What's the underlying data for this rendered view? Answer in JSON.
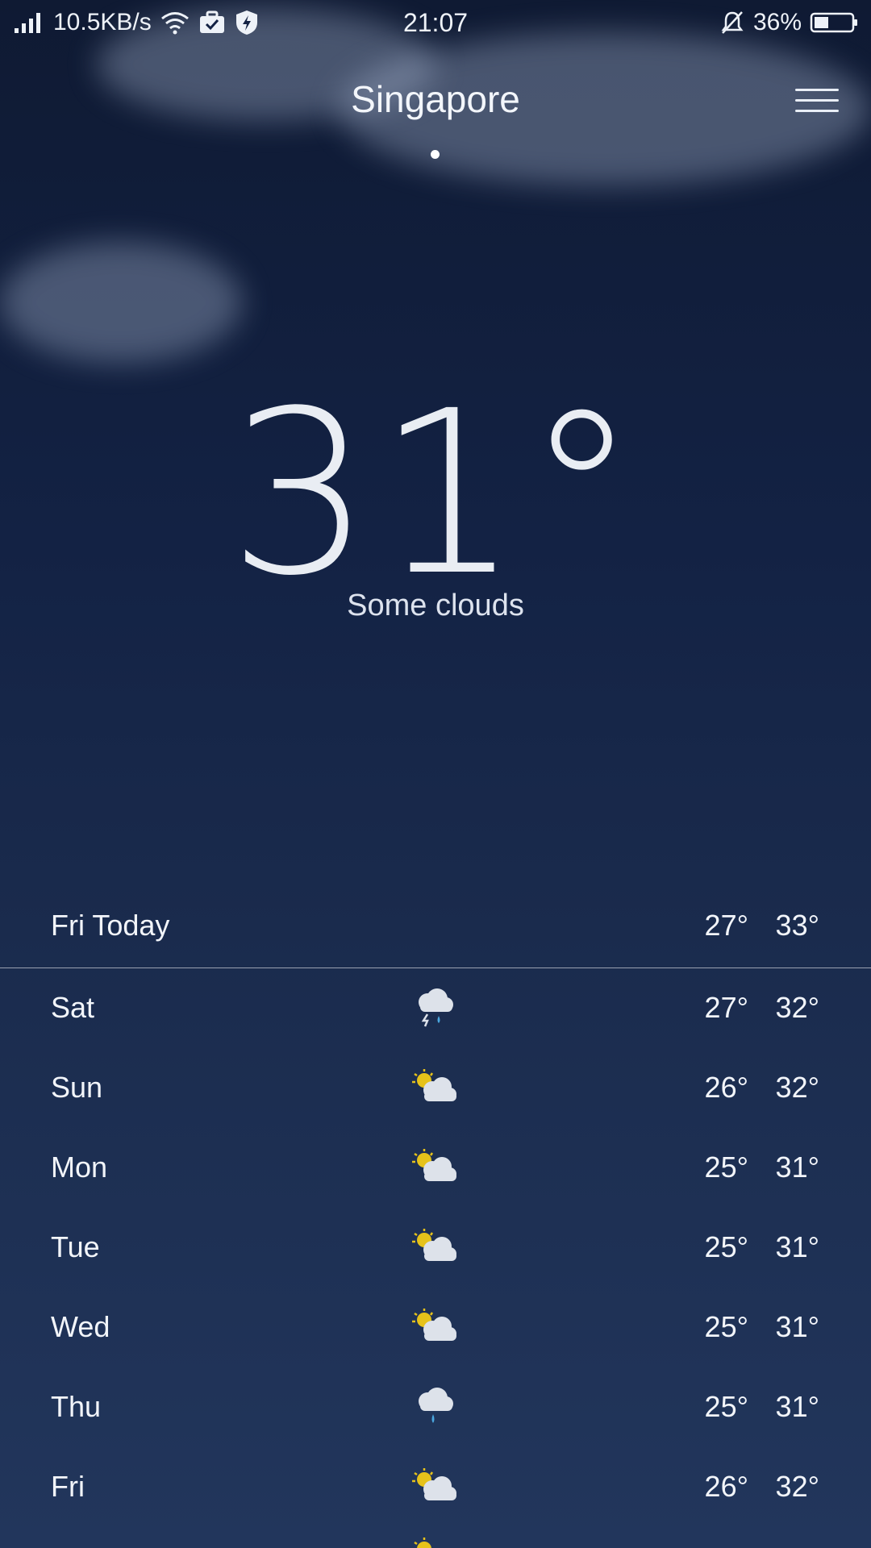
{
  "status_bar": {
    "network_speed": "10.5KB/s",
    "time": "21:07",
    "battery": "36%",
    "icons": [
      "signal-icon",
      "wifi-icon",
      "briefcase-check-icon",
      "shield-bolt-icon",
      "bell-off-icon",
      "battery-icon"
    ]
  },
  "header": {
    "city": "Singapore",
    "menu_icon": "hamburger-menu-icon"
  },
  "current": {
    "temperature": "31°",
    "condition": "Some clouds"
  },
  "forecast": [
    {
      "day": "Fri  Today",
      "icon": "",
      "low": "27°",
      "high": "33°"
    },
    {
      "day": "Sat",
      "icon": "thunder-rain-icon",
      "low": "27°",
      "high": "32°"
    },
    {
      "day": "Sun",
      "icon": "partly-cloudy-icon",
      "low": "26°",
      "high": "32°"
    },
    {
      "day": "Mon",
      "icon": "partly-cloudy-icon",
      "low": "25°",
      "high": "31°"
    },
    {
      "day": "Tue",
      "icon": "partly-cloudy-icon",
      "low": "25°",
      "high": "31°"
    },
    {
      "day": "Wed",
      "icon": "partly-cloudy-icon",
      "low": "25°",
      "high": "31°"
    },
    {
      "day": "Thu",
      "icon": "rain-icon",
      "low": "25°",
      "high": "31°"
    },
    {
      "day": "Fri",
      "icon": "partly-cloudy-icon",
      "low": "26°",
      "high": "32°"
    }
  ],
  "colors": {
    "background_top": "#0f1a33",
    "background_bottom": "#22365c",
    "sun": "#e6c21a",
    "rain": "#4aa8e0",
    "cloud": "#dde2ea"
  }
}
